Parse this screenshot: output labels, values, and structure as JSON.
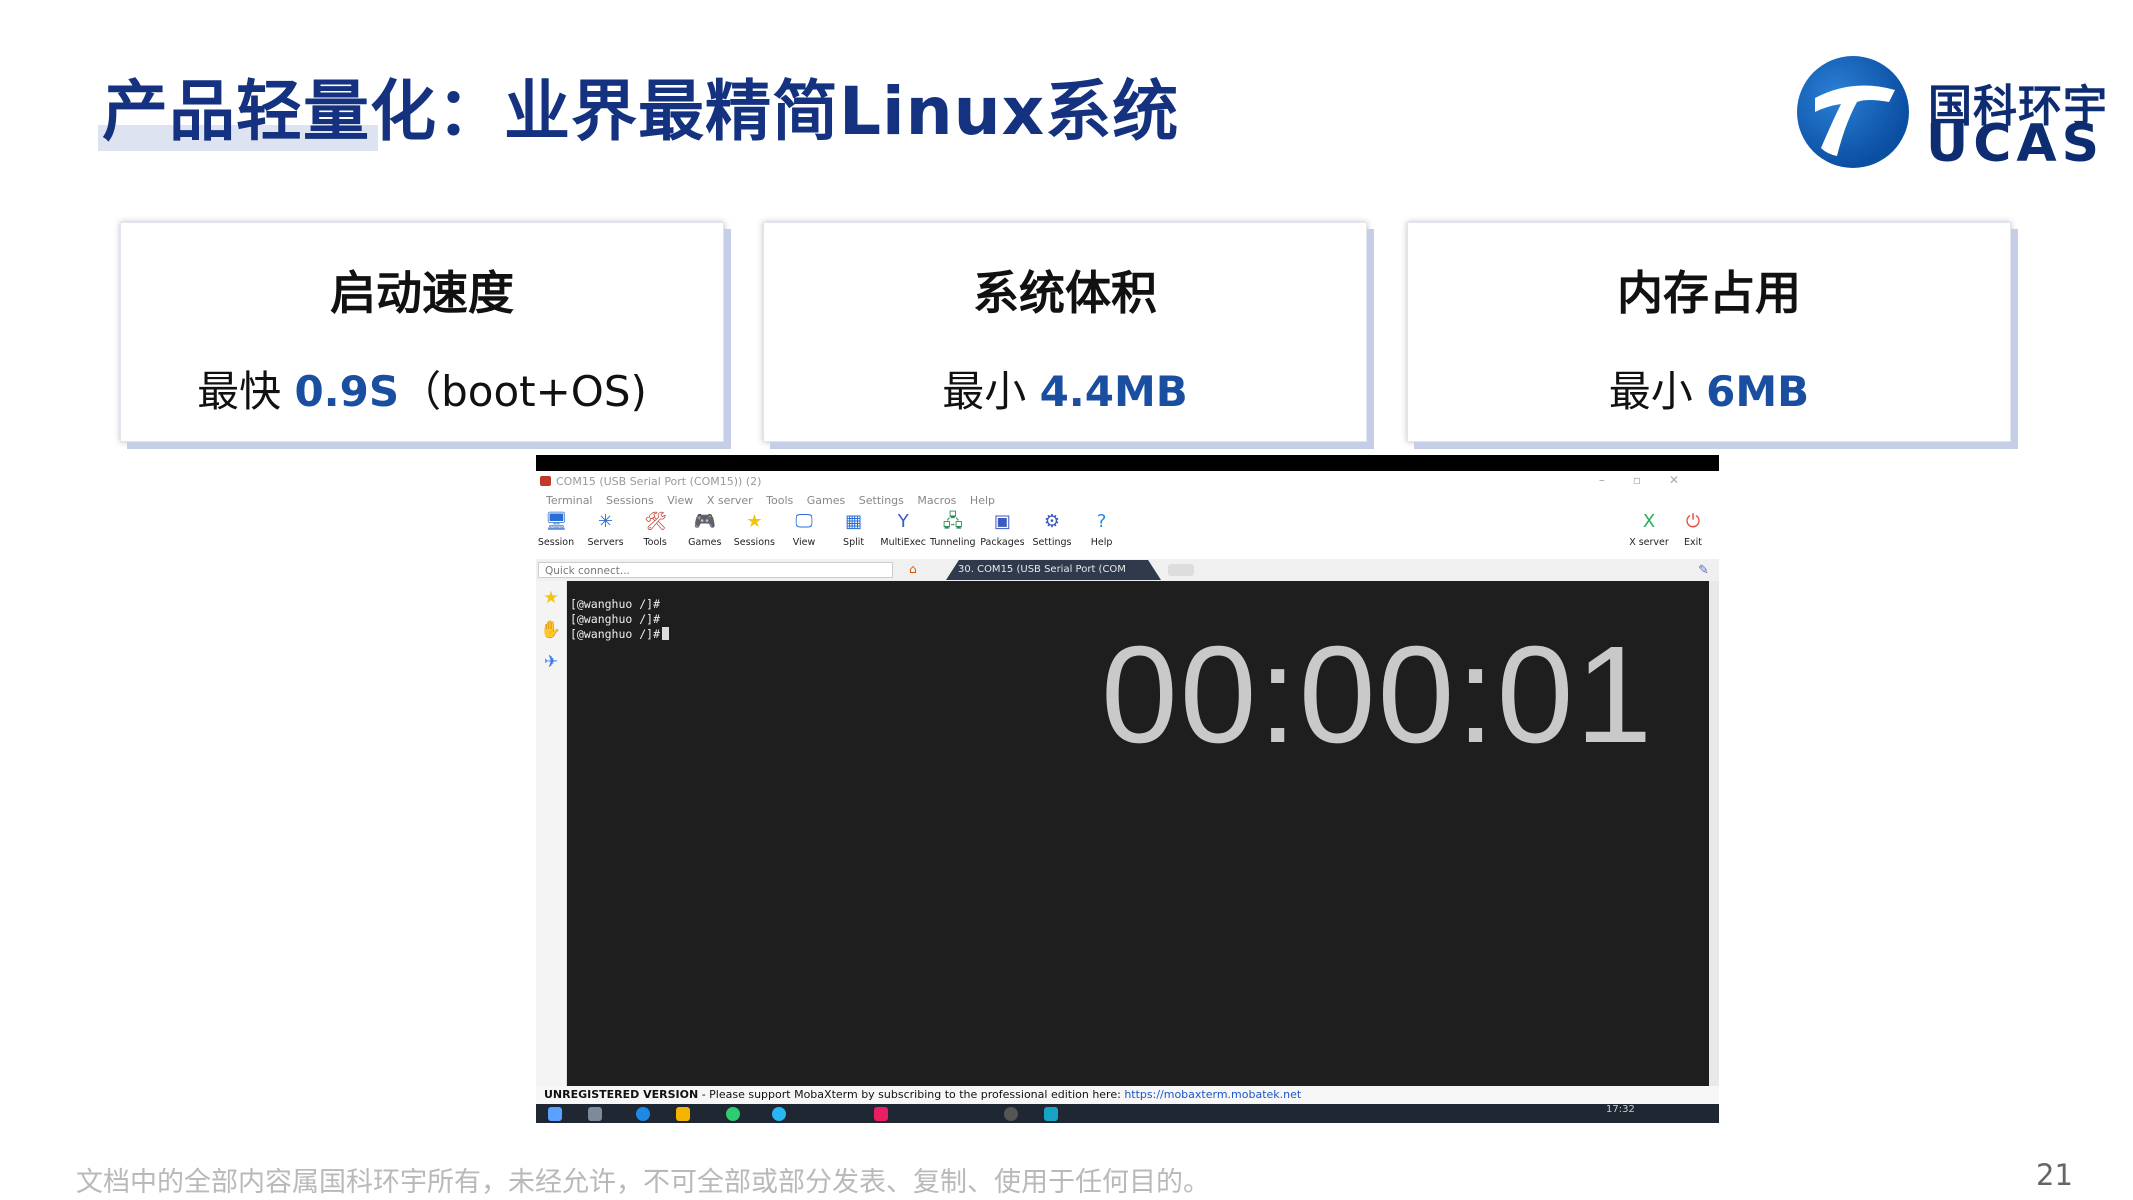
{
  "slide": {
    "title": "产品轻量化：业界最精简Linux系统",
    "logo": {
      "cn": "国科环宇",
      "en": "UCAS"
    },
    "cards": [
      {
        "title": "启动速度",
        "value_prefix": "最快 ",
        "value_highlight": "0.9S",
        "value_suffix": "（boot+OS)"
      },
      {
        "title": "系统体积",
        "value_prefix": "最小 ",
        "value_highlight": "4.4MB",
        "value_suffix": ""
      },
      {
        "title": "内存占用",
        "value_prefix": "最小 ",
        "value_highlight": "6MB",
        "value_suffix": ""
      }
    ],
    "footer": "文档中的全部内容属国科环宇所有，未经允许，不可全部或部分发表、复制、使用于任何目的。",
    "page_number": "21",
    "colors": {
      "title": "#14327f",
      "highlight": "#1a4ea0",
      "card_shadow": "#c6cde6"
    }
  },
  "app": {
    "window_title": "COM15  (USB Serial Port (COM15)) (2)",
    "menu": [
      "Terminal",
      "Sessions",
      "View",
      "X server",
      "Tools",
      "Games",
      "Settings",
      "Macros",
      "Help"
    ],
    "toolbar": [
      {
        "label": "Session",
        "icon": "session-icon",
        "glyph": "🖥",
        "color": "#2a6fd6"
      },
      {
        "label": "Servers",
        "icon": "servers-icon",
        "glyph": "✳",
        "color": "#2a6fd6"
      },
      {
        "label": "Tools",
        "icon": "tools-icon",
        "glyph": "🛠",
        "color": "#c0392b"
      },
      {
        "label": "Games",
        "icon": "games-icon",
        "glyph": "🎮",
        "color": "#555"
      },
      {
        "label": "Sessions",
        "icon": "star-icon",
        "glyph": "★",
        "color": "#f1c40f"
      },
      {
        "label": "View",
        "icon": "view-icon",
        "glyph": "🖵",
        "color": "#2a6fd6"
      },
      {
        "label": "Split",
        "icon": "split-icon",
        "glyph": "▦",
        "color": "#2a6fd6"
      },
      {
        "label": "MultiExec",
        "icon": "multiexec-icon",
        "glyph": "Y",
        "color": "#3d5bbf"
      },
      {
        "label": "Tunneling",
        "icon": "tunneling-icon",
        "glyph": "🖧",
        "color": "#2e8b57"
      },
      {
        "label": "Packages",
        "icon": "packages-icon",
        "glyph": "▣",
        "color": "#3d5bbf"
      },
      {
        "label": "Settings",
        "icon": "gear-icon",
        "glyph": "⚙",
        "color": "#3d5bbf"
      },
      {
        "label": "Help",
        "icon": "help-icon",
        "glyph": "?",
        "color": "#1e88e5"
      }
    ],
    "toolbar_right": [
      {
        "label": "X server",
        "icon": "x-server-icon",
        "glyph": "X",
        "color": "#27ae60"
      },
      {
        "label": "Exit",
        "icon": "power-icon",
        "glyph": "⏻",
        "color": "#e74c3c"
      }
    ],
    "quick_connect_placeholder": "Quick connect...",
    "session_tab": "30. COM15  (USB Serial Port (COM",
    "terminal_lines": [
      "[@wanghuo /]#",
      "[@wanghuo /]#",
      "[@wanghuo /]#"
    ],
    "timer": "00:00:01",
    "status": {
      "unregistered": "UNREGISTERED VERSION",
      "message": "  -  Please support MobaXterm by subscribing to the professional edition here:  ",
      "link": "https://mobaxterm.mobatek.net"
    },
    "taskbar_time": "17:32"
  }
}
